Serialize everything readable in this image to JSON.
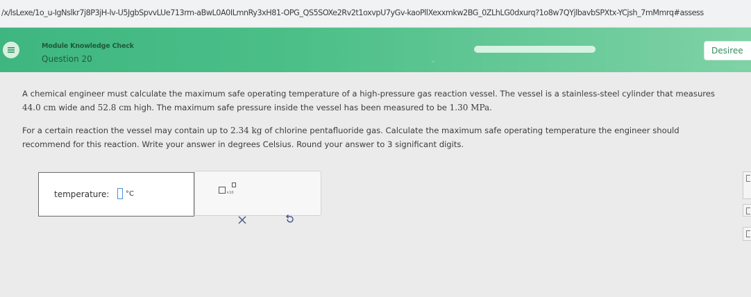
{
  "browser": {
    "url": "/x/lsLexe/1o_u-IgNslkr7j8P3jH-lv-U5JgbSpvvLUe713rm-aBwL0A0ILmnRy3xH81-OPG_QS5SOXe2Rv2t1oxvpU7yGv-kaoPllXexxmkw2BG_0ZLhLG0dxurq?1o8w7QYjlbavbSPXtx-YCjsh_7mMmrq#assess"
  },
  "header": {
    "module_title": "Module Knowledge Check",
    "question_label": "Question 20",
    "progress_fraction": 1.0,
    "user_name": "Desiree",
    "colors": {
      "bar_start": "#3fb680",
      "bar_end": "#7fd2a6",
      "text": "#1e5a3a"
    }
  },
  "question": {
    "p1_before_width": "A chemical engineer must calculate the maximum safe operating temperature of a high-pressure gas reaction vessel. The vessel is a stainless-steel cylinder that measures ",
    "width": "44.0 cm",
    "p1_between": " wide and ",
    "height": "52.8 cm",
    "p1_before_pressure": " high. The maximum safe pressure inside the vessel has been measured to be ",
    "pressure": "1.30 MPa",
    "p1_end": ".",
    "p2_before_mass": "For a certain reaction the vessel may contain up to ",
    "mass": "2.34 kg",
    "p2_after_mass": " of chlorine pentafluoride gas. Calculate the maximum safe operating temperature the engineer should recommend for this reaction. Write your answer in degrees Celsius. Round your answer to 3 significant digits."
  },
  "answer": {
    "label": "temperature:",
    "value": "",
    "unit": "°C"
  },
  "tools": {
    "sci_notation_icon": "scientific-notation-icon",
    "clear_icon": "close-icon",
    "undo_icon": "undo-icon",
    "exponent_hint": "×10"
  }
}
